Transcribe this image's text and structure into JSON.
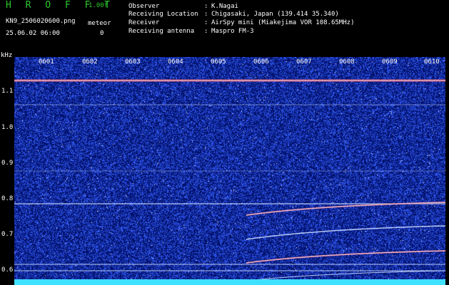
{
  "header": {
    "app_title": "H R O F F T",
    "version": "1.00f",
    "filename": "KN9_2506020600.png",
    "datetime": "25.06.02 06:00",
    "meteor_label": "meteor",
    "meteor_count": "0",
    "meta": [
      {
        "key": "Observer",
        "sep": ":",
        "value": "K.Nagai"
      },
      {
        "key": "Receiving Location",
        "sep": ":",
        "value": "Chigasaki, Japan (139.414 35.340)"
      },
      {
        "key": "Receiver",
        "sep": ":",
        "value": "AirSpy mini (Miakejima VOR 108.65MHz)"
      },
      {
        "key": "Receiving antenna",
        "sep": ":",
        "value": "Maspro FM-3"
      }
    ]
  },
  "plot": {
    "unit": "kHz",
    "y_ticks": [
      "1.1",
      "1.0",
      "0.9",
      "0.8",
      "0.7",
      "0.6"
    ],
    "x_ticks": [
      "0601",
      "0602",
      "0603",
      "0604",
      "0605",
      "0606",
      "0607",
      "0608",
      "0609",
      "0610"
    ],
    "colors": {
      "background": "#00116a",
      "noise": "#4060ff",
      "line": "#c8d8ff",
      "strong": "#ff6060",
      "baseline": "#40e0ff"
    }
  }
}
